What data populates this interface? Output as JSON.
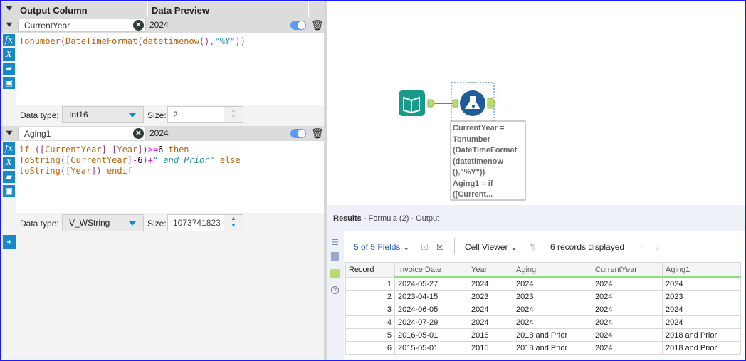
{
  "formula_panel": {
    "headers": {
      "output_column": "Output Column",
      "data_preview": "Data Preview"
    },
    "fields": [
      {
        "name": "CurrentYear",
        "preview": "2024",
        "expression_lines": [
          "Tonumber(DateTimeFormat(datetimenow(),\"%Y\"))"
        ],
        "data_type_label": "Data type:",
        "data_type": "Int16",
        "size_label": "Size:",
        "size": "2"
      },
      {
        "name": "Aging1",
        "preview": "2024",
        "expression_lines": [
          "if ([CurrentYear]-[Year])>=6 then",
          "ToString([CurrentYear]-6)+\" and Prior\" else",
          "toString([Year]) endif"
        ],
        "data_type_label": "Data type:",
        "data_type": "V_WString",
        "size_label": "Size:",
        "size": "1073741823"
      }
    ],
    "add_label": "+"
  },
  "canvas": {
    "annotation": "CurrentYear =\nTonumber\n(DateTimeFormat\n(datetimenow\n(),\"%Y\"))\nAging1 = if\n([Current..."
  },
  "results": {
    "title": "Results",
    "subtitle": " - Formula (2) - Output",
    "fields_selector": "5 of 5 Fields",
    "cell_viewer": "Cell Viewer",
    "records_displayed": "6 records displayed",
    "columns": [
      "Record",
      "Invoice Date",
      "Year",
      "Aging",
      "CurrentYear",
      "Aging1"
    ],
    "rows": [
      [
        "1",
        "2024-05-27",
        "2024",
        "2024",
        "2024",
        "2024"
      ],
      [
        "2",
        "2023-04-15",
        "2023",
        "2023",
        "2024",
        "2023"
      ],
      [
        "3",
        "2024-06-05",
        "2024",
        "2024",
        "2024",
        "2024"
      ],
      [
        "4",
        "2024-07-29",
        "2024",
        "2024",
        "2024",
        "2024"
      ],
      [
        "5",
        "2016-05-01",
        "2016",
        "2018 and Prior",
        "2024",
        "2018 and Prior"
      ],
      [
        "6",
        "2015-05-01",
        "2015",
        "2018 and Prior",
        "2024",
        "2018 and Prior"
      ]
    ]
  },
  "colors": {
    "accent": "#1788c8",
    "connector": "#a6cf5a",
    "input_tool": "#1a9a8a",
    "formula_tool": "#1f5b99"
  }
}
